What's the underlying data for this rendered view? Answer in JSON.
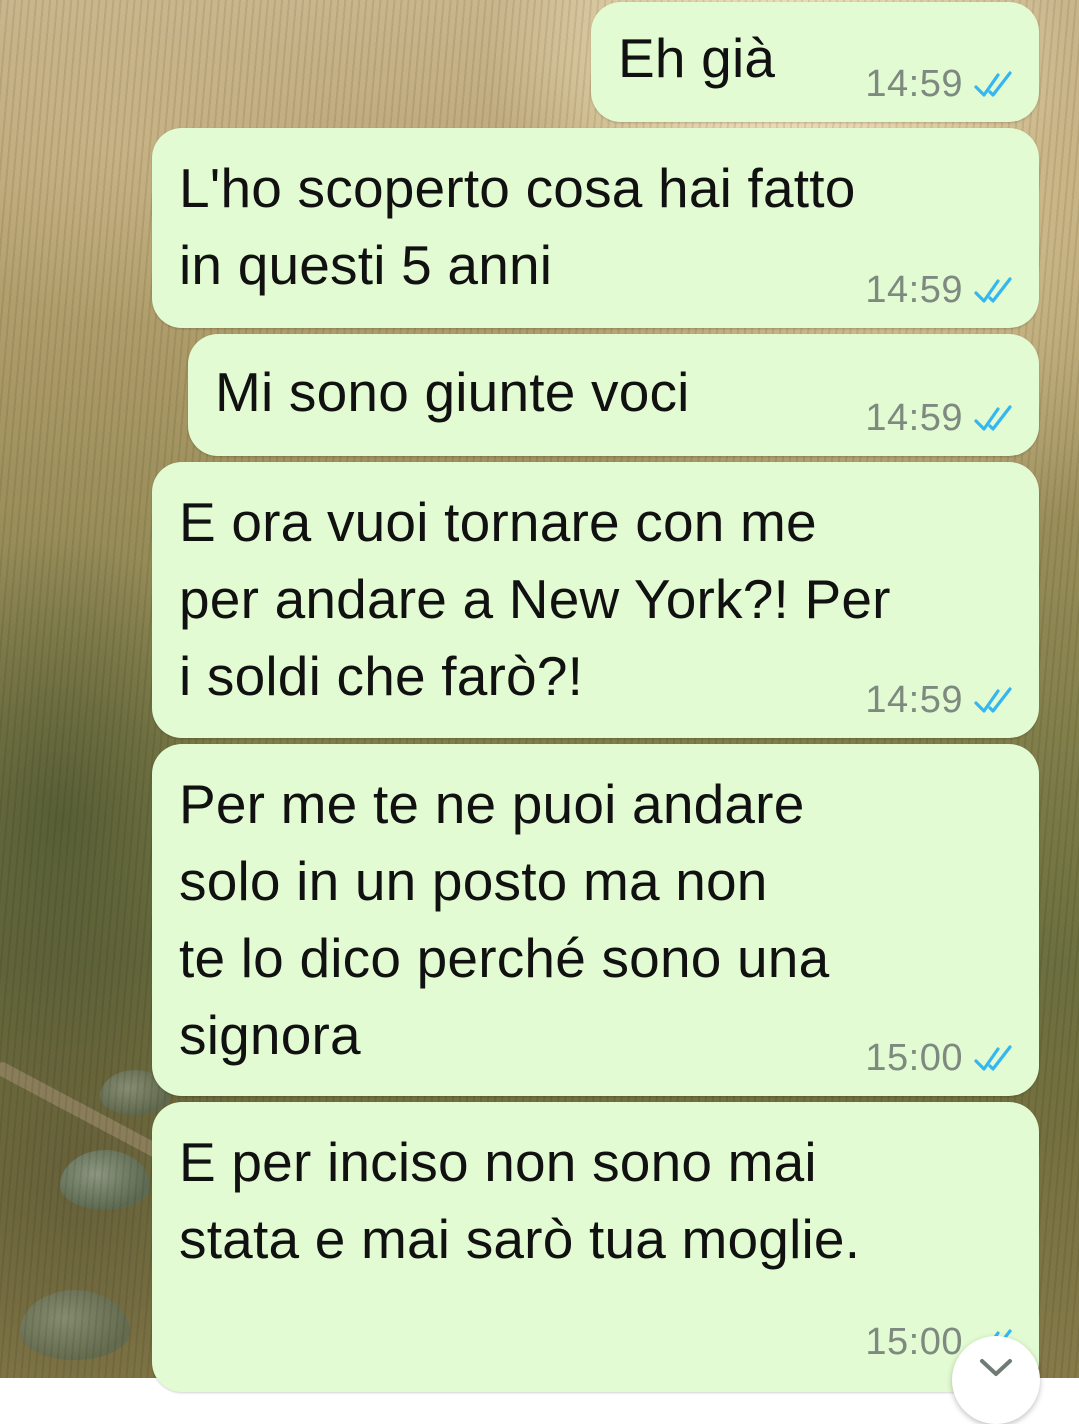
{
  "colors": {
    "bubble_background": "#e2fbd2",
    "timestamp": "#7e8a80",
    "read_ticks": "#34b7f1",
    "text": "#111111"
  },
  "messages": [
    {
      "text": "Eh già",
      "time": "14:59",
      "status": "read",
      "status_icon": "double-check-icon"
    },
    {
      "text": "L'ho scoperto cosa hai fatto\nin questi 5 anni",
      "time": "14:59",
      "status": "read",
      "status_icon": "double-check-icon"
    },
    {
      "text": "Mi sono giunte voci",
      "time": "14:59",
      "status": "read",
      "status_icon": "double-check-icon"
    },
    {
      "text": "E ora vuoi tornare con me\nper andare a New York?! Per\ni soldi che farò?!",
      "time": "14:59",
      "status": "read",
      "status_icon": "double-check-icon"
    },
    {
      "text": "Per me te ne puoi andare\nsolo in un posto ma non\nte lo dico perché sono una\nsignora",
      "time": "15:00",
      "status": "read",
      "status_icon": "double-check-icon"
    },
    {
      "text": "E per inciso non sono mai\nstata e mai sarò tua moglie.",
      "time": "15:00",
      "status": "read",
      "status_icon": "double-check-icon"
    }
  ],
  "scroll_button": {
    "icon": "chevron-down-icon"
  }
}
